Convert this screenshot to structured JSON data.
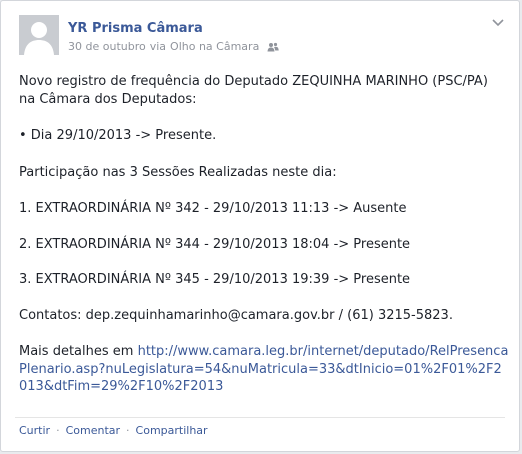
{
  "post": {
    "author": "YR Prisma Câmara",
    "date": "30 de outubro",
    "via_prefix": "via",
    "via_source": "Olho na Câmara",
    "line1": "Novo registro de frequência do Deputado ZEQUINHA MARINHO (PSC/PA) na Câmara dos Deputados:",
    "bullet": "• Dia 29/10/2013 -> Presente.",
    "participation": "Participação nas 3 Sessões Realizadas neste dia:",
    "session1": "1. EXTRAORDINÁRIA Nº 342 - 29/10/2013 11:13 -> Ausente",
    "session2": "2. EXTRAORDINÁRIA Nº 344 - 29/10/2013 18:04 -> Presente",
    "session3": "3. EXTRAORDINÁRIA Nº 345 - 29/10/2013 19:39 -> Presente",
    "contacts": "Contatos: dep.zequinhamarinho@camara.gov.br / (61) 3215-5823.",
    "details_prefix": "Mais detalhes em",
    "details_url": "http://www.camara.leg.br/internet/deputado/RelPresencaPlenario.asp?nuLegislatura=54&nuMatricula=33&dtInicio=01%2F01%2F2013&dtFim=29%2F10%2F2013"
  },
  "actions": {
    "like": "Curtir",
    "comment": "Comentar",
    "share": "Compartilhar",
    "separator": "·"
  },
  "colors": {
    "link": "#3b5998",
    "meta": "#90949c",
    "text": "#1d2129"
  },
  "icons": {
    "avatar": "default-profile-silhouette",
    "audience": "friends-audience-icon",
    "menu": "chevron-down-icon"
  }
}
